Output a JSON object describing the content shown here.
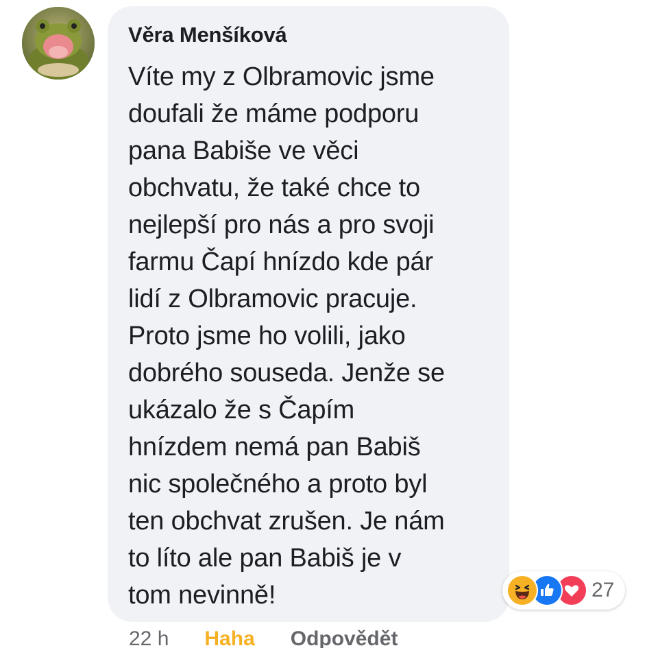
{
  "comment": {
    "author": "Věra Menšíková",
    "lines": [
      "Víte my z Olbramovic jsme",
      "doufali že máme podporu",
      "pana Babiše ve věci",
      "obchvatu, že také chce to",
      "nejlepší pro nás a pro svoji",
      "farmu Čapí hnízdo kde pár",
      "lidí z Olbramovic pracuje.",
      "Proto jsme ho volili, jako",
      "dobrého souseda. Jenže se",
      "ukázalo že s Čapím",
      "hnízdem nemá pan Babiš",
      "nic společného a proto byl",
      "ten obchvat zrušen. Je nám",
      "to líto ale pan Babiš je v",
      "tom nevinně!"
    ],
    "avatar_icon": "frog-avatar",
    "bubble_color": "#f0f2f5"
  },
  "reactions": {
    "icons": [
      "haha-icon",
      "like-icon",
      "love-icon"
    ],
    "count": "27",
    "colors": {
      "haha": "#f7b125",
      "like": "#1877f2",
      "love": "#f33e58"
    }
  },
  "actions": {
    "time": "22 h",
    "haha": "Haha",
    "reply": "Odpovědět"
  }
}
